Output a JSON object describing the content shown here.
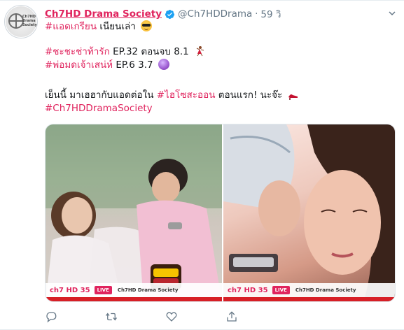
{
  "tweet": {
    "display_name": "Ch7HD Drama Society",
    "handle": "@Ch7HDDrama",
    "separator": "·",
    "time": "59 วิ",
    "avatar_text": "Ch7HD Drama Society",
    "line1": {
      "hashtag": "#แอดเกรียน",
      "text": " เนียนเล่า"
    },
    "line2": {
      "hashtag": "#ชะชะช่าท้ารัก",
      "text": " EP.32 ตอนจบ 8.1"
    },
    "line3": {
      "hashtag": "#พ่อมดเจ้าเสน่ห์",
      "text": " EP.6 3.7"
    },
    "line4": {
      "text_before": "เย็นนี้ มาเฮฮากับแอดต่อใน ",
      "hashtag": "#ไฮโซสะออน",
      "text_after": " ตอนแรก! นะจ๊ะ"
    },
    "line5": {
      "hashtag": "#Ch7HDDramaSociety"
    }
  },
  "media": {
    "left_overlay": {
      "ch": "ch7 HD 35",
      "live": "LIVE",
      "social": "Ch7HD Drama Society"
    },
    "right_overlay": {
      "ch": "ch7 HD 35",
      "live": "LIVE",
      "social": "Ch7HD Drama Society"
    }
  },
  "icons": {
    "verified": "verified-badge-icon",
    "caret": "chevron-down-icon",
    "reply": "reply-icon",
    "retweet": "retweet-icon",
    "like": "heart-icon",
    "share": "share-icon"
  },
  "colors": {
    "accent": "#e0245e",
    "muted": "#657786",
    "verified": "#1da1f2",
    "text": "#14171a"
  }
}
